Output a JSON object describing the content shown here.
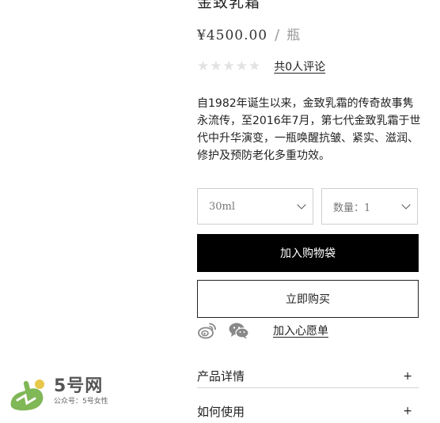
{
  "product": {
    "title": "金致乳霜",
    "price": "¥4500.00",
    "separator": "/",
    "unit": "瓶",
    "rating_stars": 0,
    "reviews_label": "共0人评论",
    "description": "自1982年诞生以来，金致乳霜的传奇故事隽永流传，至2016年7月，第七代金致乳霜于世代中升华演变，一瓶唤醒抗皱、紧实、滋润、修护及预防老化多重功效。"
  },
  "options": {
    "size_value": "30ml",
    "quantity_value": "数量：1"
  },
  "actions": {
    "add_to_bag": "加入购物袋",
    "buy_now": "立即购买",
    "wishlist": "加入心愿单",
    "share_icons": [
      "weibo-icon",
      "wechat-icon"
    ]
  },
  "accordion": [
    {
      "label": "产品详情",
      "icon": "+"
    },
    {
      "label": "如何使用",
      "icon": "+"
    }
  ],
  "watermark": {
    "brand": "5号网",
    "subtitle": "公众号：5号女性"
  },
  "colors": {
    "primary_button_bg": "#000000",
    "primary_button_text": "#ffffff",
    "border": "#cfcfcf",
    "muted_text": "#999999",
    "star_empty": "#e2e2e2",
    "watermark_green": "#6aaa3a"
  }
}
